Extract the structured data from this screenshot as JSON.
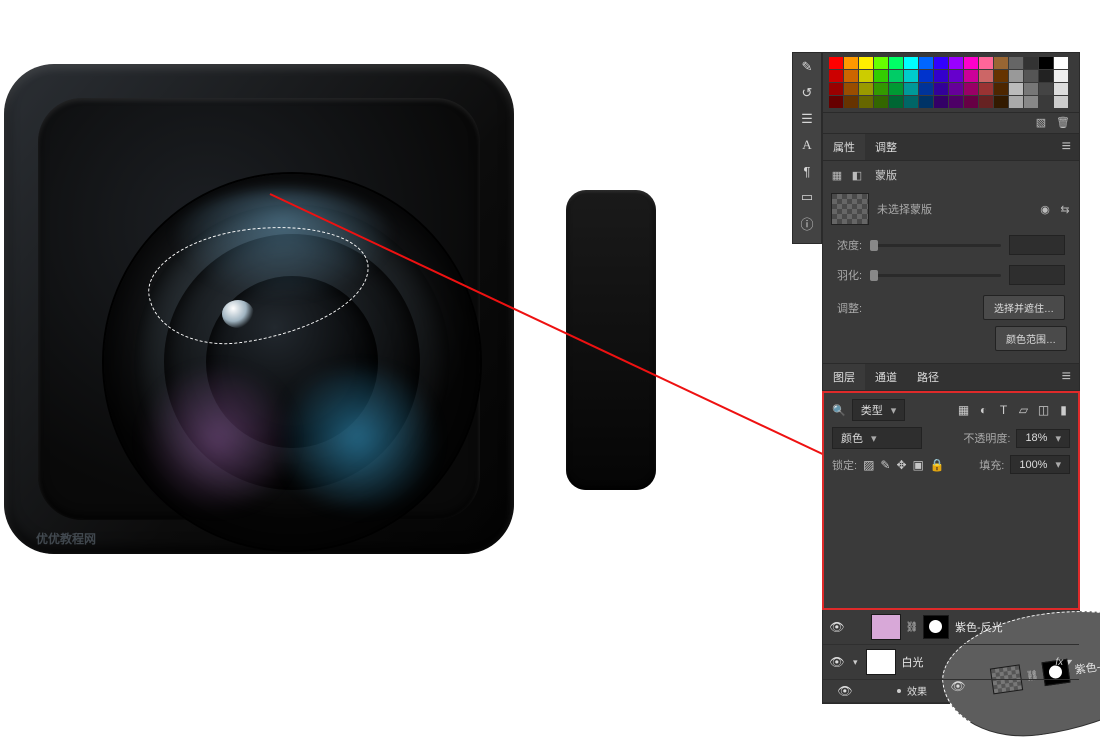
{
  "watermark": "优优教程网",
  "swatch_colors": [
    "#ff0000",
    "#ff9900",
    "#ffee00",
    "#66ff00",
    "#00ff66",
    "#00ffff",
    "#0066ff",
    "#3300ff",
    "#9900ff",
    "#ff00cc",
    "#ff6699",
    "#996633",
    "#666666",
    "#333333",
    "#000000",
    "#ffffff",
    "#cc0000",
    "#cc6600",
    "#cccc00",
    "#33cc00",
    "#00cc66",
    "#00cccc",
    "#0033cc",
    "#3300cc",
    "#6600cc",
    "#cc0099",
    "#cc6666",
    "#663300",
    "#999999",
    "#555555",
    "#222222",
    "#eeeeee",
    "#990000",
    "#994d00",
    "#999900",
    "#339900",
    "#009933",
    "#009999",
    "#003399",
    "#330099",
    "#660099",
    "#990066",
    "#993333",
    "#4d2600",
    "#bbbbbb",
    "#777777",
    "#444444",
    "#dddddd",
    "#660000",
    "#663300",
    "#666600",
    "#336600",
    "#006633",
    "#006666",
    "#003366",
    "#330066",
    "#4d0066",
    "#660044",
    "#662222",
    "#331a00",
    "#aaaaaa",
    "#888888",
    "#3a3a3a",
    "#cccccc"
  ],
  "tool_icons": [
    "brush-icon",
    "history-icon",
    "sliders-icon",
    "type-icon",
    "paragraph-icon",
    "note-icon",
    "info-icon"
  ],
  "props": {
    "tab_properties": "属性",
    "tab_adjust": "调整",
    "mask_title": "蒙版",
    "mask_status": "未选择蒙版",
    "density_label": "浓度:",
    "feather_label": "羽化:",
    "refine_label": "调整:",
    "btn_select_subject": "选择并遮住…",
    "btn_color_range": "颜色范围…"
  },
  "layers": {
    "tab_layers": "图层",
    "tab_channels": "通道",
    "tab_paths": "路径",
    "filter_kind": "类型",
    "blend_mode": "颜色",
    "opacity_label": "不透明度:",
    "opacity_value": "18%",
    "lock_label": "锁定:",
    "fill_label": "填充:",
    "fill_value": "100%",
    "items": [
      {
        "name": "紫色-反光-上",
        "selected": true,
        "mask": true,
        "thumb": "checker"
      },
      {
        "name": "紫色-反光",
        "selected": false,
        "mask": true,
        "thumb": "pink"
      },
      {
        "name": "白光",
        "selected": false,
        "mask": false,
        "thumb": "white",
        "fx": true
      }
    ],
    "fx_label": "fx",
    "fx_group": "效果"
  }
}
